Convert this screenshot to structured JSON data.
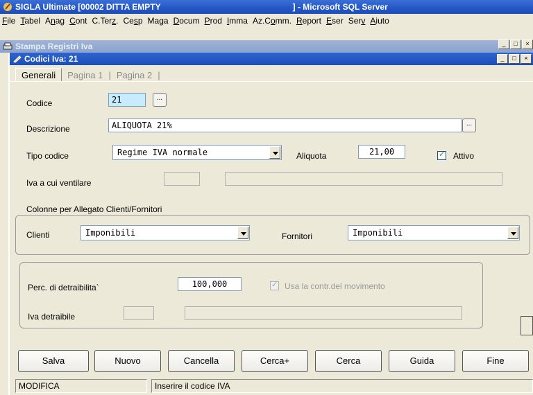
{
  "app": {
    "title_left": "SIGLA Ultimate [00002 DITTA EMPTY",
    "title_right": "] - Microsoft SQL Server"
  },
  "menu": [
    "File",
    "Tabel",
    "Anag",
    "Cont",
    "C.Terz.",
    "Cesp",
    "Maga",
    "Docum",
    "Prod",
    "Imma",
    "Az.Comm.",
    "Report",
    "Eser",
    "Serv",
    "Aiuto"
  ],
  "background_window": {
    "title": "Stampa Registri Iva"
  },
  "window": {
    "title": "Codici Iva: 21"
  },
  "tabs": [
    "Generali",
    "Pagina 1",
    "Pagina 2"
  ],
  "form": {
    "codice_label": "Codice",
    "codice_value": "21",
    "descrizione_label": "Descrizione",
    "descrizione_value": "ALIQUOTA 21%",
    "tipo_codice_label": "Tipo codice",
    "tipo_codice_value": "Regime IVA normale",
    "aliquota_label": "Aliquota",
    "aliquota_value": "21,00",
    "attivo_label": "Attivo",
    "attivo_checked": true,
    "ventilare_label": "Iva a cui ventilare",
    "colonne_label": "Colonne per Allegato Clienti/Fornitori",
    "clienti_label": "Clienti",
    "clienti_value": "Imponibili",
    "fornitori_label": "Fornitori",
    "fornitori_value": "Imponibili",
    "perc_label": "Perc. di detraibilita`",
    "perc_value": "100,000",
    "usa_contr_label": "Usa la contr.del movimento",
    "iva_detraibile_label": "Iva detraibile"
  },
  "buttons": [
    "Salva",
    "Nuovo",
    "Cancella",
    "Cerca+",
    "Cerca",
    "Guida",
    "Fine"
  ],
  "status": {
    "mode": "MODIFICA",
    "message": "Inserire il codice IVA"
  },
  "colors": {
    "title_blue": "#2457c5",
    "field_highlight": "#c7ecff",
    "window_bg": "#ece9d8"
  }
}
